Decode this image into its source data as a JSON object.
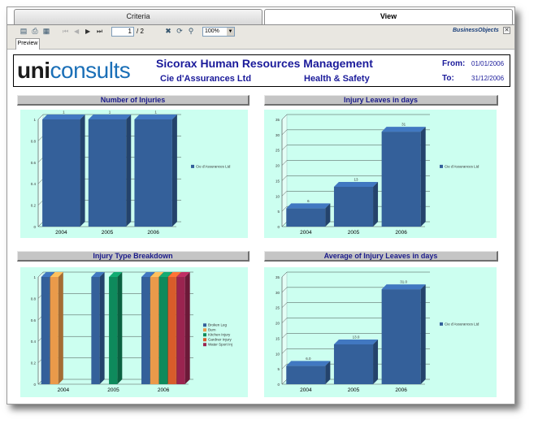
{
  "tabs": {
    "criteria": "Criteria",
    "view": "View"
  },
  "toolbar": {
    "page_current": "1",
    "page_total": "/ 2",
    "zoom": "100%",
    "brand": "BusinessObjects",
    "preview_tab": "Preview",
    "icons": [
      "export-icon",
      "print-icon",
      "group-tree-icon",
      "first-page-icon",
      "prev-page-icon",
      "next-page-icon",
      "last-page-icon",
      "stop-icon",
      "refresh-icon",
      "search-icon",
      "close-icon"
    ]
  },
  "header": {
    "logo_uni": "uni",
    "logo_consults": "consults",
    "title": "Sicorax Human Resources Management",
    "company": "Cie d'Assurances Ltd",
    "department": "Health & Safety",
    "from_label": "From:",
    "from_date": "01/01/2006",
    "to_label": "To:",
    "to_date": "31/12/2006"
  },
  "colors": {
    "plot_bg": "#ccfff0",
    "bar_blue": "#34609a",
    "bar_orange": "#ea9a4a",
    "bar_green": "#0e8a5c",
    "bar_redorange": "#d85c2a",
    "bar_maroon": "#9a2450",
    "title_text": "#1a1a9a"
  },
  "chart_data": [
    {
      "type": "bar",
      "title": "Number of Injuries",
      "categories": [
        "2004",
        "2005",
        "2006"
      ],
      "series": [
        {
          "name": "Cie d'Assurances Ltd",
          "values": [
            1,
            1,
            1
          ]
        }
      ],
      "ylim": [
        0,
        1
      ],
      "yticks": [
        "0",
        "0.2",
        "0.4",
        "0.6",
        "0.8",
        "1"
      ],
      "data_labels": [
        "1",
        "1",
        "1"
      ],
      "legend": "right",
      "grid": true
    },
    {
      "type": "bar",
      "title": "Injury Leaves in days",
      "categories": [
        "2004",
        "2005",
        "2006"
      ],
      "series": [
        {
          "name": "Cie d'Assurances Ltd",
          "values": [
            6,
            13,
            31
          ]
        }
      ],
      "ylim": [
        0,
        35
      ],
      "yticks": [
        "0",
        "5",
        "10",
        "15",
        "20",
        "25",
        "30",
        "35"
      ],
      "data_labels": [
        "6",
        "13",
        "31"
      ],
      "legend": "right",
      "grid": true
    },
    {
      "type": "bar",
      "title": "Injury Type Breakdown",
      "categories": [
        "2004",
        "2005",
        "2006"
      ],
      "series": [
        {
          "name": "Broken Leg",
          "values": [
            1,
            1,
            1
          ]
        },
        {
          "name": "Burn",
          "values": [
            1,
            0,
            1
          ]
        },
        {
          "name": "Kitchen Injury",
          "values": [
            0,
            1,
            1
          ]
        },
        {
          "name": "Gardner Injury",
          "values": [
            0,
            0,
            1
          ]
        },
        {
          "name": "Water Sport Inj",
          "values": [
            0,
            0,
            1
          ]
        }
      ],
      "ylim": [
        0,
        1
      ],
      "yticks": [
        "0",
        "0.2",
        "0.4",
        "0.6",
        "0.8",
        "1"
      ],
      "legend": "right",
      "grid": true
    },
    {
      "type": "bar",
      "title": "Average of Injury Leaves in days",
      "categories": [
        "2004",
        "2005",
        "2006"
      ],
      "series": [
        {
          "name": "Cie d'Assurances Ltd",
          "values": [
            6.0,
            13.0,
            31.0
          ]
        }
      ],
      "ylim": [
        0,
        35
      ],
      "yticks": [
        "0",
        "5",
        "10",
        "15",
        "20",
        "25",
        "30",
        "35"
      ],
      "data_labels": [
        "6.0",
        "13.0",
        "31.0"
      ],
      "legend": "right",
      "grid": true
    }
  ]
}
